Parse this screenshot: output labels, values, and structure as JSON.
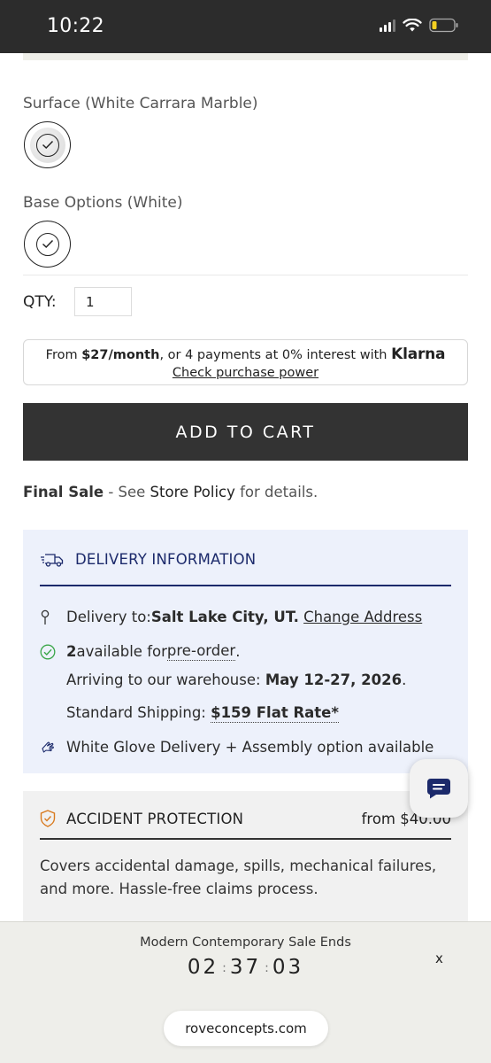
{
  "status_bar": {
    "time": "10:22"
  },
  "options": {
    "surface_label": "Surface (White Carrara Marble)",
    "base_label": "Base Options (White)"
  },
  "qty": {
    "label": "QTY:",
    "value": "1"
  },
  "klarna": {
    "prefix": "From ",
    "monthly": "$27/month",
    "middle": ", or 4 payments at 0% interest with ",
    "brand": "Klarna",
    "link": "Check purchase power"
  },
  "add_to_cart_label": "ADD TO CART",
  "final_sale": {
    "strong": "Final Sale",
    "pre": " - See ",
    "link": "Store Policy",
    "post": " for details."
  },
  "delivery": {
    "title": "DELIVERY INFORMATION",
    "to_label": "Delivery to: ",
    "city": "Salt Lake City, UT.",
    "change_link": "Change Address",
    "available_count": "2",
    "available_text": " available for ",
    "preorder": "pre-order",
    "period": ".",
    "arriving_label": "Arriving to our warehouse: ",
    "arriving_dates": "May 12-27, 2026",
    "shipping_label": "Standard Shipping: ",
    "shipping_rate": "$159 Flat Rate*",
    "white_glove": "White Glove Delivery + Assembly option available"
  },
  "accident": {
    "title": "ACCIDENT PROTECTION",
    "price": "from $40.00",
    "description": "Covers accidental damage, spills, mechanical failures, and more. Hassle-free claims process."
  },
  "sale_banner": {
    "title": "Modern Contemporary Sale Ends",
    "hours": "02",
    "minutes": "37",
    "seconds": "03",
    "separator": ":",
    "close": "x"
  },
  "url": "roveconcepts.com",
  "colors": {
    "dark_button": "#333333",
    "delivery_bg": "#edf1fb",
    "delivery_accent": "#1c2a6b",
    "check_green": "#3aa648",
    "shield_orange": "#d97a1e"
  }
}
